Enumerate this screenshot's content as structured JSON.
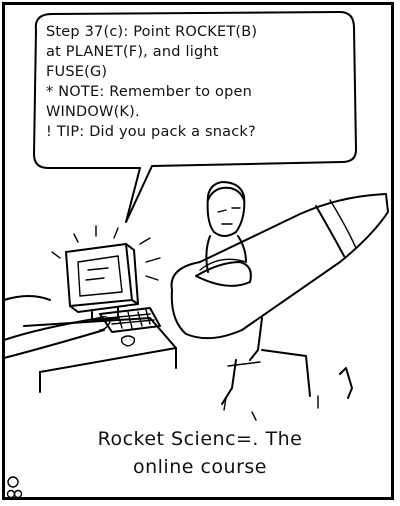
{
  "speech_bubble": {
    "lines": [
      "Step 37(c): Point ROCKET(B)",
      "at PLANET(F), and light",
      "FUSE(G)",
      "* NOTE: Remember to open",
      "WINDOW(K).",
      "! TIP: Did you pack a snack?"
    ]
  },
  "caption": {
    "line1": "Rocket Scienc=. The",
    "line2": "online course"
  },
  "signature": {
    "text": "g8"
  }
}
